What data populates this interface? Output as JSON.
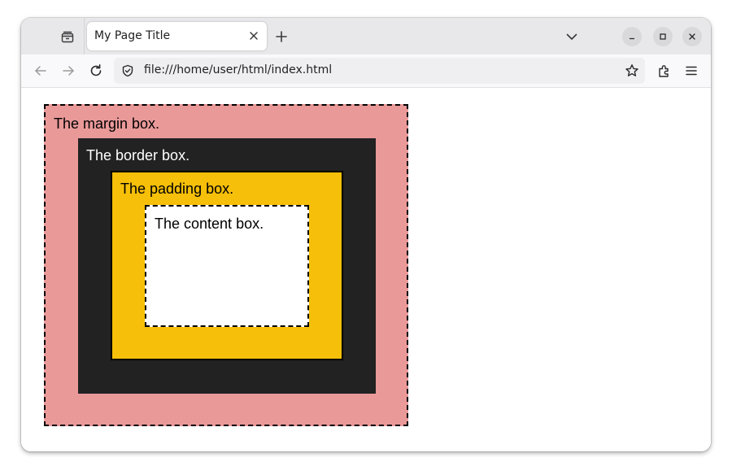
{
  "browser": {
    "tab": {
      "title": "My Page Title"
    },
    "url": "file:///home/user/html/index.html",
    "icons": {
      "list_tabs": "tab-list-icon",
      "close_tab": "close-icon",
      "new_tab": "plus-icon",
      "all_tabs": "chevron-down-icon",
      "minimize": "minimize-icon",
      "maximize": "maximize-icon",
      "close_window": "close-icon",
      "back": "arrow-left-icon",
      "forward": "arrow-right-icon",
      "reload": "reload-icon",
      "site_info": "shield-icon",
      "bookmark": "star-icon",
      "extensions": "puzzle-icon",
      "menu": "hamburger-menu-icon"
    }
  },
  "page": {
    "margin_box": {
      "label": "The margin box.",
      "color": "#ea9999"
    },
    "border_box": {
      "label": "The border box.",
      "color": "#222222"
    },
    "padding_box": {
      "label": "The padding box.",
      "color": "#f6bf09"
    },
    "content_box": {
      "label": "The content box.",
      "color": "#ffffff"
    }
  }
}
